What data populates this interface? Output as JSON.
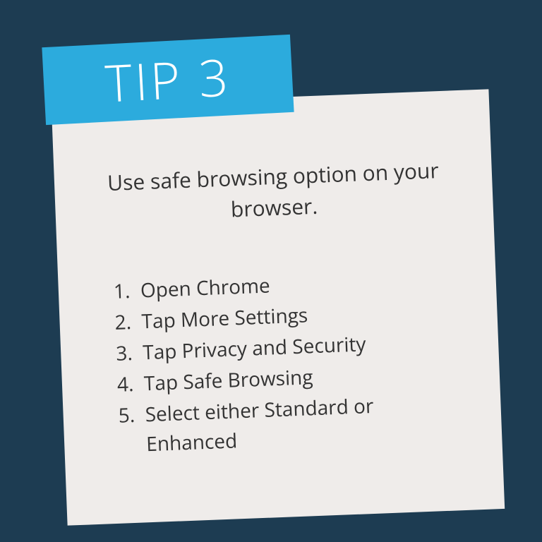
{
  "badge": {
    "label": "TIP 3"
  },
  "heading": "Use safe browsing option on your browser.",
  "steps": [
    "Open Chrome",
    "Tap More Settings",
    "Tap Privacy and Security",
    "Tap Safe Browsing",
    "Select either Standard or Enhanced"
  ],
  "colors": {
    "background": "#1d3c52",
    "card": "#efecea",
    "badge": "#2cabdd",
    "text": "#333333",
    "badgeText": "#ffffff"
  }
}
